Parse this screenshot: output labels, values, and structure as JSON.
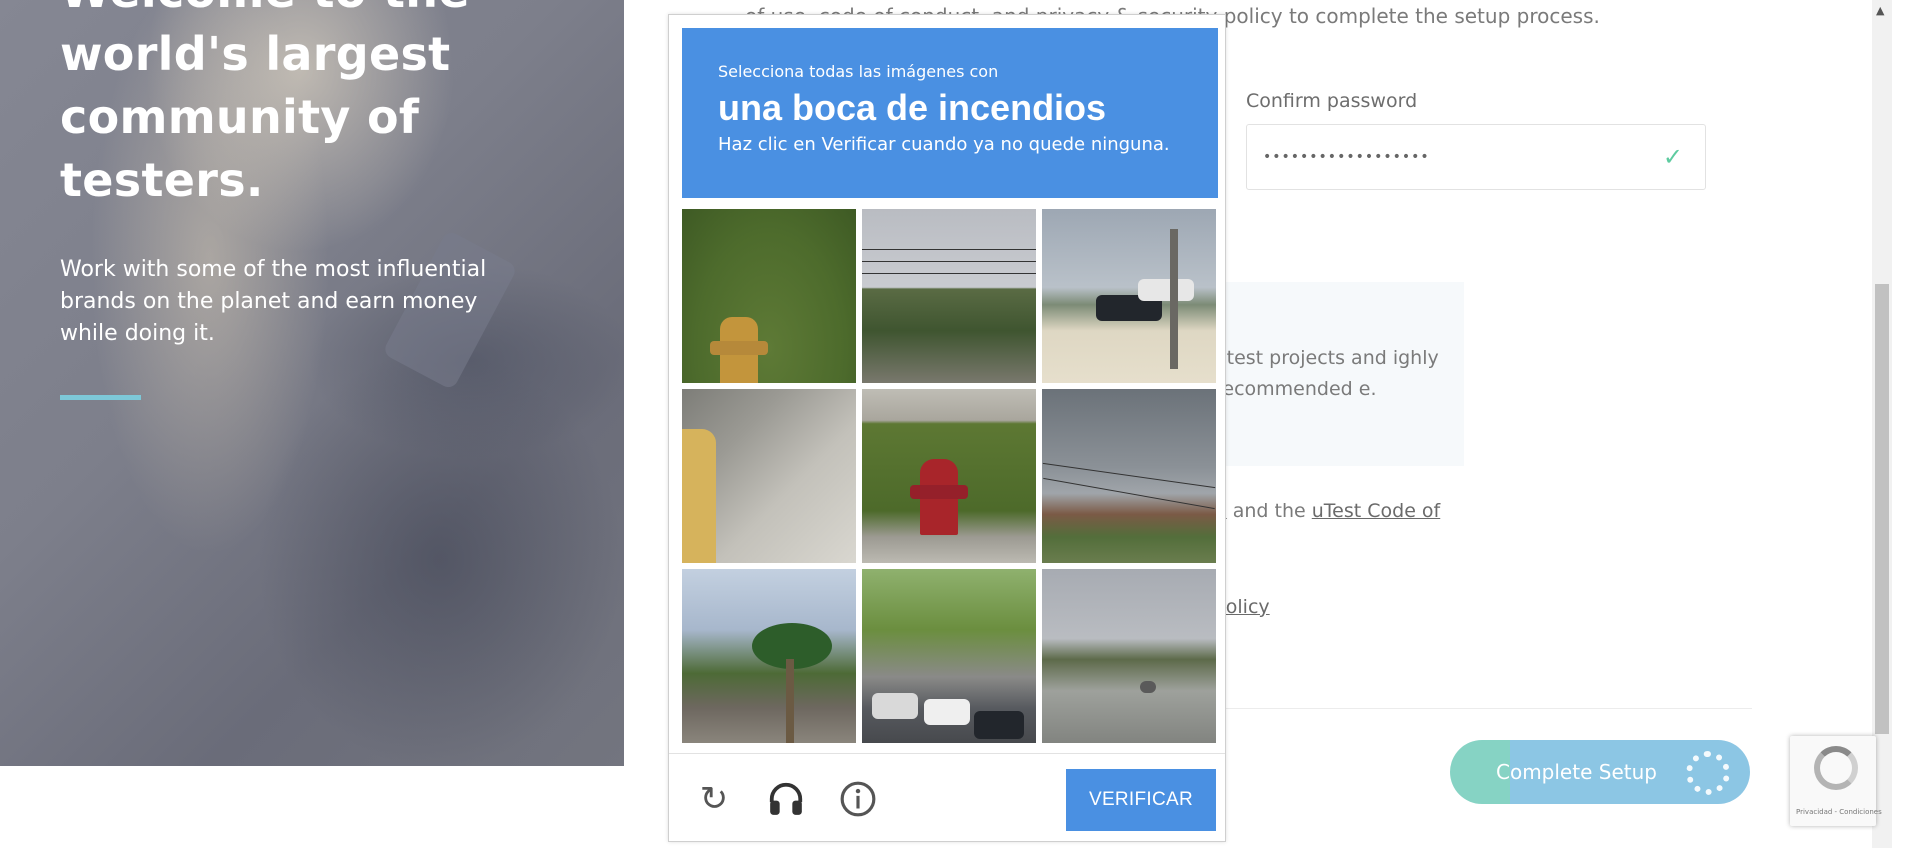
{
  "hero": {
    "title": "Welcome to the world's largest community of testers.",
    "subtitle": "Work with some of the most influential brands on the planet and earn money while doing it."
  },
  "form": {
    "intro_text": "of use, code of conduct, and privacy & security policy to complete the setup process.",
    "confirm_password_label": "Confirm password",
    "confirm_password_value": "••••••••••••••••••",
    "info_text": "atest projects and ighly recommended e.",
    "terms_prefix_link": "e",
    "terms_middle": " and the ",
    "terms_link": "uTest Code of",
    "policy_link": " Policy",
    "complete_button": "Complete Setup"
  },
  "recaptcha_badge": {
    "footer_text": "Privacidad - Condiciones"
  },
  "challenge": {
    "instruction_small": "Selecciona todas las imágenes con",
    "instruction_object": "una boca de incendios",
    "instruction_sub": "Haz clic en Verificar cuando ya no quede ninguna.",
    "verify_button": "VERIFICAR",
    "icons": [
      "reload-icon",
      "headphones-icon",
      "info-icon"
    ],
    "tiles": [
      {
        "label": "hydrant-on-grass"
      },
      {
        "label": "trees-and-wires"
      },
      {
        "label": "parked-cars-lot"
      },
      {
        "label": "yellow-hydrant-sidewalk"
      },
      {
        "label": "red-hydrant-grass"
      },
      {
        "label": "power-lines-field"
      },
      {
        "label": "palm-tree-houses"
      },
      {
        "label": "street-traffic-light"
      },
      {
        "label": "empty-road"
      }
    ]
  },
  "colors": {
    "accent_blue": "#4a90e2",
    "check_green": "#5ecba0",
    "hero_accent": "#7dc8d8"
  }
}
